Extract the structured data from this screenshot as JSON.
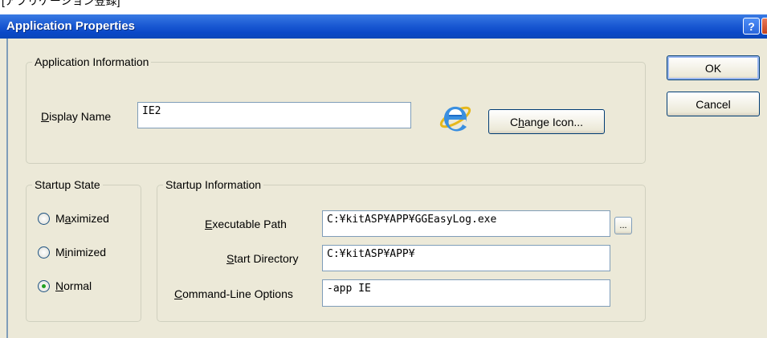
{
  "caption": "[アプリケーション登録]",
  "window": {
    "title": "Application Properties",
    "help_glyph": "?",
    "close_glyph": "x"
  },
  "app_info": {
    "group_title": "Application Information",
    "display_name_mnemonic": "D",
    "display_name_rest": "isplay Name",
    "display_name_value": "IE2",
    "icon": "internet-explorer-icon",
    "change_icon_pre": "C",
    "change_icon_mnemonic": "h",
    "change_icon_rest": "ange Icon..."
  },
  "startup_state": {
    "group_title": "Startup State",
    "options": [
      {
        "pre": "M",
        "mnemonic": "a",
        "rest": "ximized",
        "selected": false
      },
      {
        "pre": "M",
        "mnemonic": "i",
        "rest": "nimized",
        "selected": false
      },
      {
        "pre": "",
        "mnemonic": "N",
        "rest": "ormal",
        "selected": true
      }
    ]
  },
  "startup_info": {
    "group_title": "Startup Information",
    "exec_mnemonic": "E",
    "exec_rest": "xecutable Path",
    "exec_value": "C:¥kitASP¥APP¥GGEasyLog.exe",
    "browse_label": "...",
    "start_mnemonic": "S",
    "start_rest": "tart Directory",
    "start_value": "C:¥kitASP¥APP¥",
    "cmd_mnemonic": "C",
    "cmd_rest": "ommand-Line Options",
    "cmd_value": "-app IE"
  },
  "buttons": {
    "ok": "OK",
    "cancel": "Cancel"
  },
  "colors": {
    "titlebar": "#0a48c8",
    "dialog_bg": "#ece9d8",
    "radio_selected": "#21a121"
  }
}
